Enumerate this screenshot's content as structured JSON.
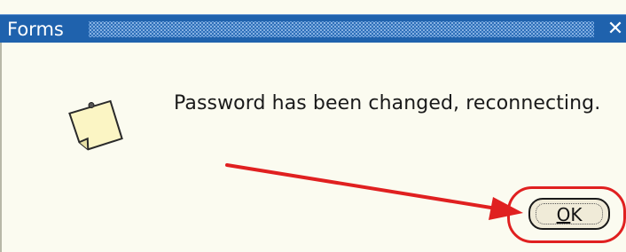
{
  "dialog": {
    "title": "Forms",
    "close_glyph": "✕",
    "message": "Password has been changed, reconnecting.",
    "icon": "note-icon",
    "ok_button": {
      "mnemonic": "O",
      "rest": "K"
    }
  },
  "annotation": {
    "arrow_color": "#e02020",
    "ring_color": "#e02020"
  },
  "colors": {
    "titlebar": "#1f62ad",
    "dialog_background": "#fbfbf0"
  }
}
